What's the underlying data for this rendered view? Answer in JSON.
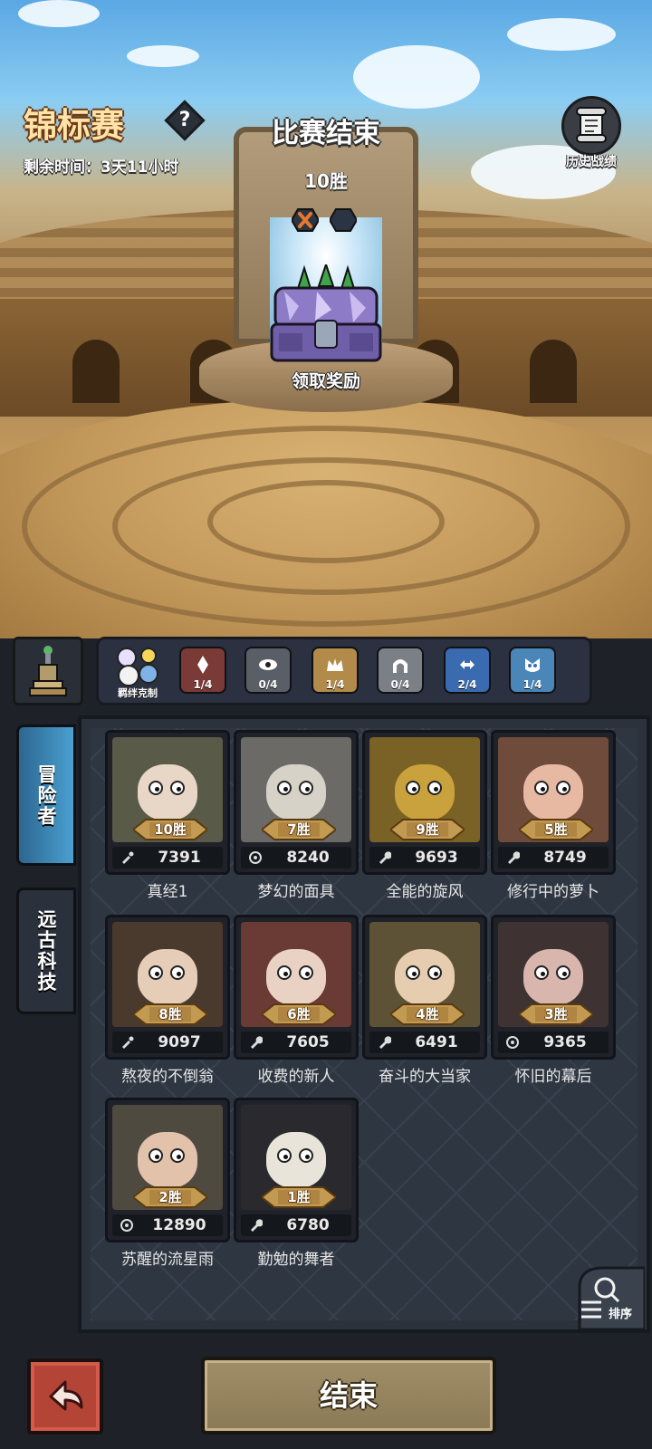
{
  "header": {
    "title": "锦标赛",
    "help_symbol": "?",
    "remaining_time": "剩余时间：3天11小时",
    "match_status": "比赛结束",
    "wins": "10胜",
    "claim_reward": "领取奖励",
    "history_label": "历史战绩"
  },
  "bonds": {
    "main_label": "羁绊克制",
    "items": [
      {
        "icon": "diamond-rune-icon",
        "count": "1/4",
        "color": "#7a3a36"
      },
      {
        "icon": "eye-icon",
        "count": "0/4",
        "color": "#5a5e66"
      },
      {
        "icon": "crown-icon",
        "count": "1/4",
        "color": "#b28a4a"
      },
      {
        "icon": "arch-icon",
        "count": "0/4",
        "color": "#7b7f86"
      },
      {
        "icon": "swap-arrows-icon",
        "count": "2/4",
        "color": "#3a6bb0"
      },
      {
        "icon": "mask-icon",
        "count": "1/4",
        "color": "#4a86b8"
      }
    ]
  },
  "tabs": {
    "adventurers": "冒险者",
    "ancient_tech": "远古科技"
  },
  "roster": [
    {
      "wins": "10胜",
      "power": "7391",
      "name": "真经1",
      "power_icon": "brush-icon",
      "bg": "#5a5a48",
      "skin": "#e8d7c6"
    },
    {
      "wins": "7胜",
      "power": "8240",
      "name": "梦幻的面具",
      "power_icon": "target-icon",
      "bg": "#6c6a66",
      "skin": "#d6d2c8"
    },
    {
      "wins": "9胜",
      "power": "9693",
      "name": "全能的旋风",
      "power_icon": "wrench-icon",
      "bg": "#7a6226",
      "skin": "#c9a23e"
    },
    {
      "wins": "5胜",
      "power": "8749",
      "name": "修行中的萝卜",
      "power_icon": "wrench-icon",
      "bg": "#6e4b3a",
      "skin": "#e8b9a2"
    },
    {
      "wins": "8胜",
      "power": "9097",
      "name": "熬夜的不倒翁",
      "power_icon": "brush-icon",
      "bg": "#4a3a2e",
      "skin": "#e6cdb8"
    },
    {
      "wins": "6胜",
      "power": "7605",
      "name": "收费的新人",
      "power_icon": "wrench-icon",
      "bg": "#6a3a34",
      "skin": "#e9d2c4"
    },
    {
      "wins": "4胜",
      "power": "6491",
      "name": "奋斗的大当家",
      "power_icon": "wrench-icon",
      "bg": "#5e5236",
      "skin": "#e7cdb0"
    },
    {
      "wins": "3胜",
      "power": "9365",
      "name": "怀旧的幕后",
      "power_icon": "target-icon",
      "bg": "#3e3232",
      "skin": "#d9b6ad"
    },
    {
      "wins": "2胜",
      "power": "12890",
      "name": "苏醒的流星雨",
      "power_icon": "target-icon",
      "bg": "#4e4a40",
      "skin": "#e2c2aa"
    },
    {
      "wins": "1胜",
      "power": "6780",
      "name": "勤勉的舞者",
      "power_icon": "wrench-icon",
      "bg": "#2a2a2e",
      "skin": "#e8e4da"
    }
  ],
  "sort_label": "排序",
  "end_button": "结束",
  "colors": {
    "title": "#ffe3a8",
    "panel": "#2b323c",
    "active_tab": "#3d86b8",
    "inactive_tab": "#2a313c",
    "end_button": "#98865f",
    "back_button": "#b34436"
  }
}
